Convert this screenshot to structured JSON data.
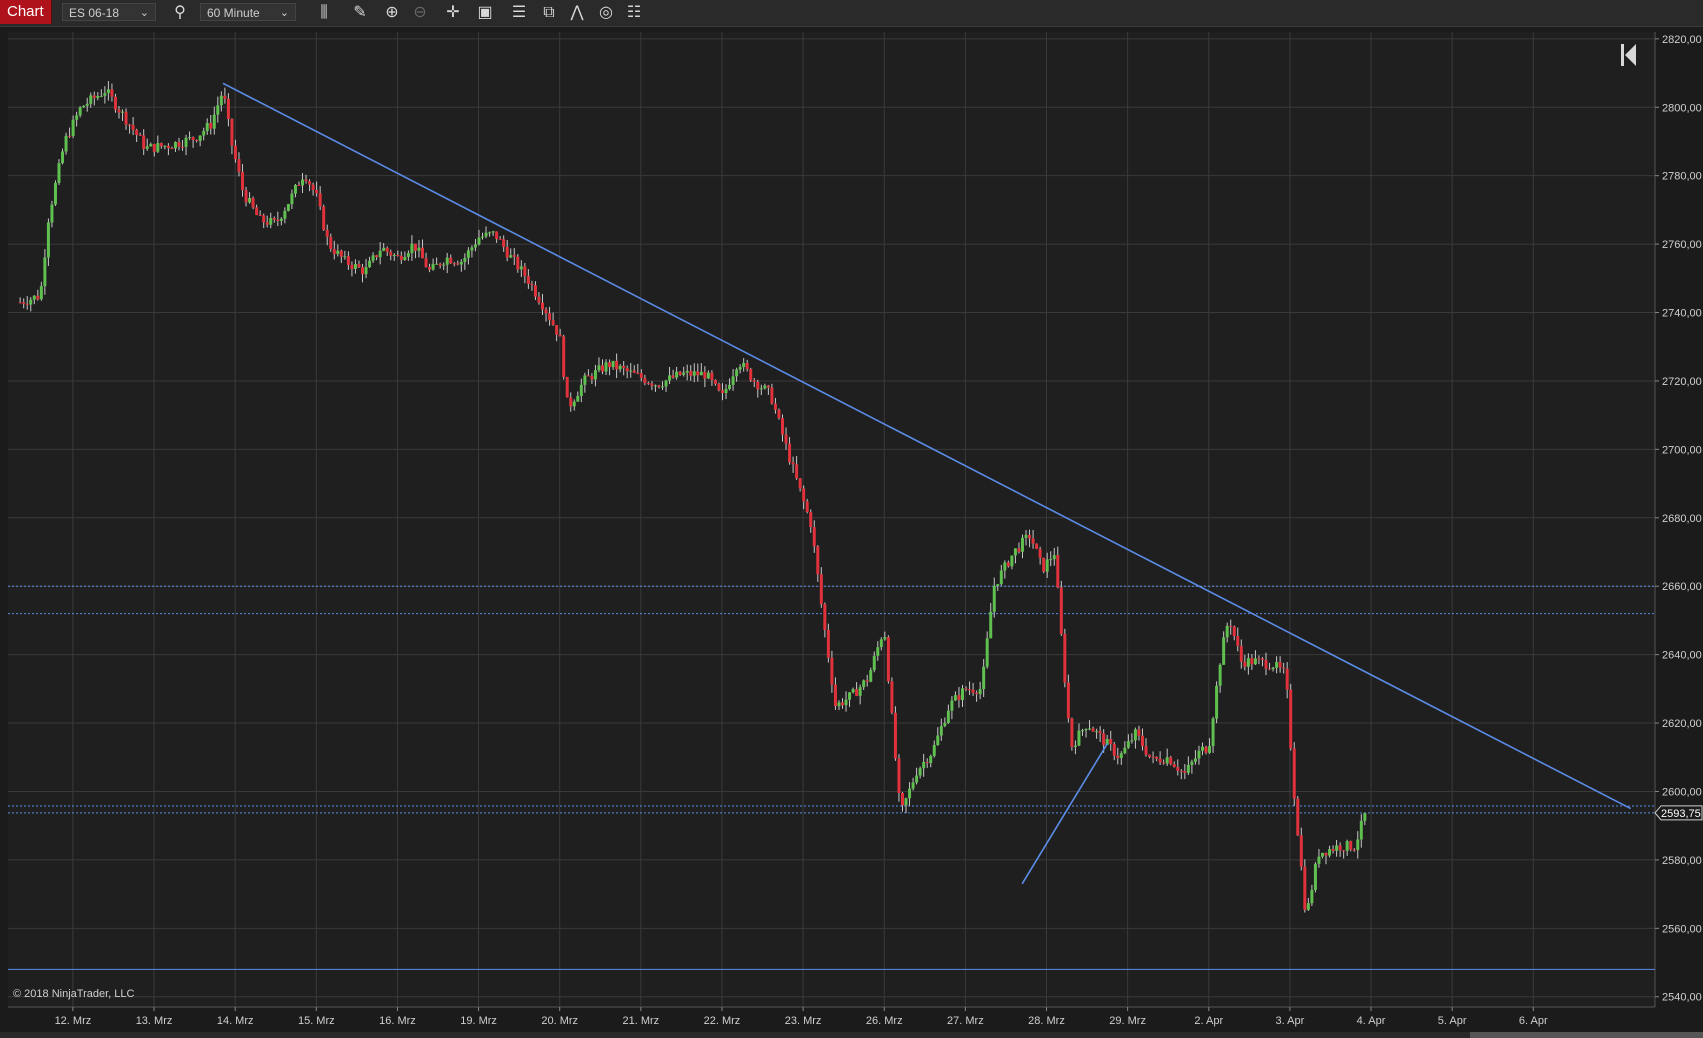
{
  "toolbar": {
    "tab_label": "Chart",
    "instrument": "ES 06-18",
    "interval": "60 Minute",
    "icons": [
      "search-icon",
      "bar-type-icon",
      "pencil-icon",
      "zoom-in-icon",
      "zoom-out-icon",
      "crosshair-icon",
      "data-box-icon",
      "columns-icon",
      "drawing-tools-icon",
      "indicators-icon",
      "strategies-icon",
      "properties-icon"
    ]
  },
  "colors": {
    "background": "#1f1f1f",
    "grid": "#3a3a3a",
    "up_candle": "#5fbf4f",
    "down_candle": "#e0323a",
    "wick": "#c8c8c8",
    "trendline": "#5b8ce8",
    "tab_red": "#b0121b"
  },
  "copyright": "© 2018 NinjaTrader, LLC",
  "chart_data": {
    "type": "candlestick",
    "instrument": "ES 06-18",
    "interval": "60 Minute",
    "ylim": [
      2537,
      2822
    ],
    "y_ticks": [
      "2820,00",
      "2800,00",
      "2780,00",
      "2760,00",
      "2740,00",
      "2720,00",
      "2700,00",
      "2680,00",
      "2660,00",
      "2640,00",
      "2620,00",
      "2600,00",
      "2580,00",
      "2560,00",
      "2540,00"
    ],
    "y_tick_values": [
      2820,
      2800,
      2780,
      2760,
      2740,
      2720,
      2700,
      2680,
      2660,
      2640,
      2620,
      2600,
      2580,
      2560,
      2540
    ],
    "x_labels": [
      "12. Mrz",
      "13. Mrz",
      "14. Mrz",
      "15. Mrz",
      "16. Mrz",
      "19. Mrz",
      "20. Mrz",
      "21. Mrz",
      "22. Mrz",
      "23. Mrz",
      "26. Mrz",
      "27. Mrz",
      "28. Mrz",
      "29. Mrz",
      "2. Apr",
      "3. Apr",
      "4. Apr",
      "5. Apr",
      "6. Apr"
    ],
    "x_range_days": [
      -0.8,
      19.5
    ],
    "price_path": [
      [
        -0.65,
        2743
      ],
      [
        -0.4,
        2745
      ],
      [
        -0.3,
        2768
      ],
      [
        -0.1,
        2790
      ],
      [
        0.1,
        2800
      ],
      [
        0.4,
        2805
      ],
      [
        0.7,
        2795
      ],
      [
        0.9,
        2788
      ],
      [
        1.2,
        2789
      ],
      [
        1.5,
        2791
      ],
      [
        1.7,
        2795
      ],
      [
        1.85,
        2805
      ],
      [
        1.95,
        2790
      ],
      [
        2.1,
        2775
      ],
      [
        2.3,
        2767
      ],
      [
        2.5,
        2766
      ],
      [
        2.7,
        2774
      ],
      [
        2.85,
        2781
      ],
      [
        3.0,
        2774
      ],
      [
        3.15,
        2760
      ],
      [
        3.35,
        2755
      ],
      [
        3.6,
        2752
      ],
      [
        3.8,
        2759
      ],
      [
        4.0,
        2756
      ],
      [
        4.2,
        2760
      ],
      [
        4.4,
        2752
      ],
      [
        4.6,
        2756
      ],
      [
        4.8,
        2755
      ],
      [
        5.0,
        2762
      ],
      [
        5.2,
        2763
      ],
      [
        5.4,
        2756
      ],
      [
        5.6,
        2750
      ],
      [
        5.8,
        2742
      ],
      [
        6.0,
        2733
      ],
      [
        6.1,
        2712
      ],
      [
        6.3,
        2720
      ],
      [
        6.6,
        2725
      ],
      [
        6.9,
        2722
      ],
      [
        7.2,
        2719
      ],
      [
        7.5,
        2722
      ],
      [
        7.8,
        2722
      ],
      [
        8.0,
        2715
      ],
      [
        8.2,
        2726
      ],
      [
        8.4,
        2720
      ],
      [
        8.6,
        2716
      ],
      [
        8.8,
        2700
      ],
      [
        9.0,
        2685
      ],
      [
        9.1,
        2678
      ],
      [
        9.25,
        2650
      ],
      [
        9.4,
        2625
      ],
      [
        9.6,
        2628
      ],
      [
        9.8,
        2633
      ],
      [
        10.0,
        2648
      ],
      [
        10.1,
        2620
      ],
      [
        10.2,
        2593
      ],
      [
        10.4,
        2606
      ],
      [
        10.6,
        2612
      ],
      [
        10.8,
        2625
      ],
      [
        11.0,
        2630
      ],
      [
        11.2,
        2630
      ],
      [
        11.35,
        2660
      ],
      [
        11.6,
        2670
      ],
      [
        11.8,
        2675
      ],
      [
        11.95,
        2665
      ],
      [
        12.1,
        2670
      ],
      [
        12.2,
        2640
      ],
      [
        12.3,
        2613
      ],
      [
        12.5,
        2620
      ],
      [
        12.7,
        2615
      ],
      [
        12.9,
        2610
      ],
      [
        13.1,
        2617
      ],
      [
        13.3,
        2609
      ],
      [
        13.5,
        2610
      ],
      [
        13.7,
        2605
      ],
      [
        13.9,
        2612
      ],
      [
        14.0,
        2613
      ],
      [
        14.15,
        2640
      ],
      [
        14.25,
        2651
      ],
      [
        14.4,
        2638
      ],
      [
        14.6,
        2638
      ],
      [
        14.8,
        2637
      ],
      [
        14.95,
        2634
      ],
      [
        15.05,
        2600
      ],
      [
        15.2,
        2563
      ],
      [
        15.35,
        2582
      ],
      [
        15.6,
        2584
      ],
      [
        15.8,
        2584
      ],
      [
        15.95,
        2595
      ]
    ],
    "trendlines": [
      {
        "from": [
          1.85,
          2807
        ],
        "to": [
          19.2,
          2595
        ]
      },
      {
        "from": [
          11.7,
          2573
        ],
        "to": [
          12.75,
          2614
        ]
      }
    ],
    "horizontal_levels": [
      {
        "value": 2660,
        "style": "dotted"
      },
      {
        "value": 2652,
        "style": "dotted"
      },
      {
        "value": 2595.75,
        "style": "dotted"
      },
      {
        "value": 2593.75,
        "style": "dotted"
      },
      {
        "value": 2548,
        "style": "solid"
      }
    ],
    "last_price": "2593,75",
    "last_price_value": 2593.75
  }
}
